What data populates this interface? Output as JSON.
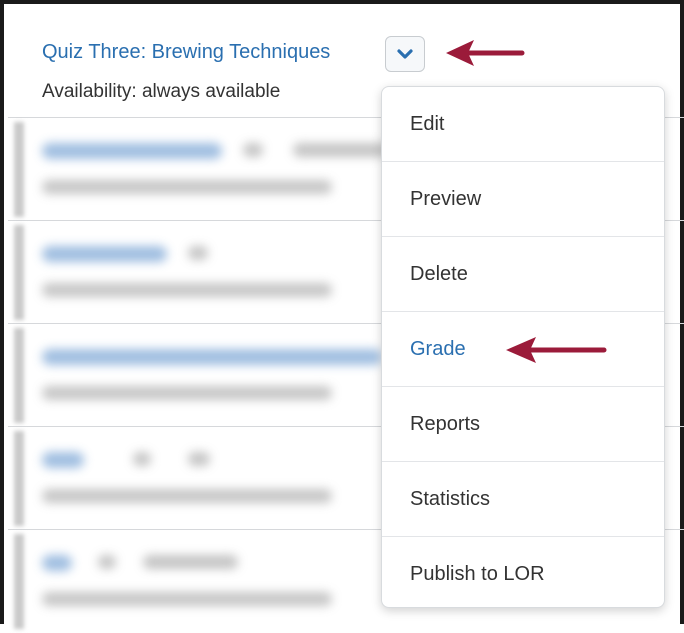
{
  "quiz": {
    "title": "Quiz Three: Brewing Techniques",
    "availability": "Availability: always available"
  },
  "context_menu": {
    "items": [
      {
        "label": "Edit"
      },
      {
        "label": "Preview"
      },
      {
        "label": "Delete"
      },
      {
        "label": "Grade"
      },
      {
        "label": "Reports"
      },
      {
        "label": "Statistics"
      },
      {
        "label": "Publish to LOR"
      }
    ]
  },
  "colors": {
    "link": "#2a6fb0",
    "arrow": "#9b1b3a",
    "text": "#333333"
  },
  "icons": {
    "dropdown": "chevron-down-icon",
    "pointer": "arrow-left-icon"
  }
}
